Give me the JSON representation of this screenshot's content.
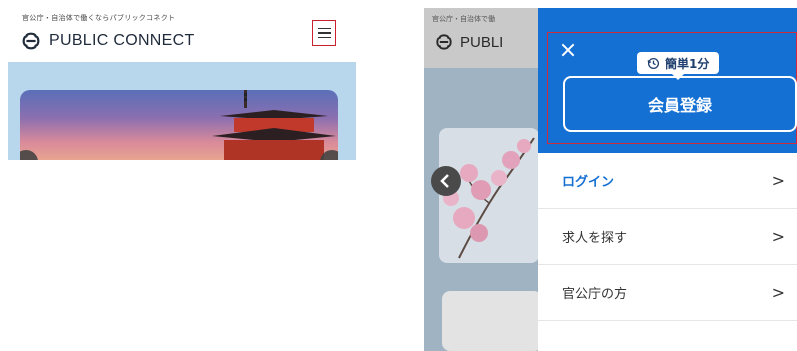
{
  "left": {
    "tagline": "官公庁・自治体で働くならパブリックコネクト",
    "brand": "PUBLIC CONNECT"
  },
  "right": {
    "background": {
      "tagline": "官公庁・自治体で働",
      "brand": "PUBLI"
    },
    "drawer": {
      "badge_text": "簡単1分",
      "register_label": "会員登録",
      "menu_items": [
        {
          "label": "ログイン",
          "chevron": ">"
        },
        {
          "label": "求人を探す",
          "chevron": ">"
        },
        {
          "label": "官公庁の方",
          "chevron": ">"
        }
      ]
    }
  },
  "colors": {
    "drawer_blue": "#1570d4",
    "highlight_red": "#cf2b3a"
  }
}
